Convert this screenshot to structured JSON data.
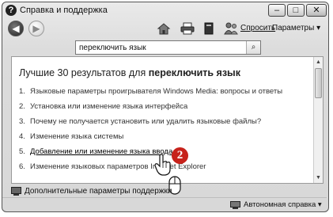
{
  "window": {
    "title": "Справка и поддержка",
    "controls": {
      "minimize": "–",
      "maximize": "□",
      "close": "✕"
    }
  },
  "toolbar": {
    "back_glyph": "◀",
    "forward_glyph": "▶",
    "ask_label": "Спросить",
    "params_label": "Параметры ▾"
  },
  "search": {
    "value": "переключить язык",
    "button_glyph": "⌕"
  },
  "results": {
    "heading_prefix": "Лучшие 30 результатов для ",
    "heading_query": "переключить язык",
    "items": [
      {
        "num": "1.",
        "text": "Языковые параметры проигрывателя Windows Media: вопросы и ответы"
      },
      {
        "num": "2.",
        "text": "Установка или изменение языка интерфейса"
      },
      {
        "num": "3.",
        "text": "Почему не получается установить или удалить языковые файлы?"
      },
      {
        "num": "4.",
        "text": "Изменение языка системы"
      },
      {
        "num": "5.",
        "text": "Добавление или изменение языка ввода"
      },
      {
        "num": "6.",
        "text": "Изменение языковых параметров Internet Explorer"
      }
    ]
  },
  "overlay": {
    "step_badge": "2"
  },
  "footer": {
    "more_params": "Дополнительные параметры поддержки",
    "offline_help": "Автономная справка ▾"
  },
  "colors": {
    "badge": "#c7221b"
  },
  "icons": [
    "help-icon",
    "home-icon",
    "print-icon",
    "browse-help-icon",
    "ask-person-icon",
    "search-icon",
    "hand-cursor-icon",
    "mouse-icon",
    "support-options-icon",
    "offline-help-icon"
  ]
}
